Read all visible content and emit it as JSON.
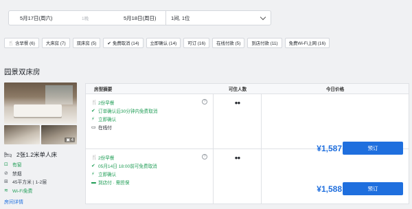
{
  "search": {
    "checkin": "5月17日(周六)",
    "nights": "1晚",
    "checkout": "5月18日(周日)",
    "guests": "1间, 1位"
  },
  "filters": [
    {
      "icon": "meal-icon",
      "glyph": "🍴",
      "label": "含早餐 (6)"
    },
    {
      "icon": "",
      "glyph": "",
      "label": "大床房 (7)"
    },
    {
      "icon": "",
      "glyph": "",
      "label": "双床房 (5)"
    },
    {
      "icon": "check-icon",
      "glyph": "✔",
      "label": "免费取消 (14)"
    },
    {
      "icon": "",
      "glyph": "",
      "label": "立即确认 (14)"
    },
    {
      "icon": "",
      "glyph": "",
      "label": "可订 (16)"
    },
    {
      "icon": "",
      "glyph": "",
      "label": "在线付款 (5)"
    },
    {
      "icon": "",
      "glyph": "",
      "label": "到店付款 (11)"
    },
    {
      "icon": "",
      "glyph": "",
      "label": "免费Wi-Fi上网 (16)"
    }
  ],
  "room": {
    "title": "园景双床房",
    "photo_count": "4",
    "bed": "2张1.2米单人床",
    "attributes": [
      {
        "icon": "window-icon",
        "glyph": "⊡",
        "text": "有窗",
        "green": true
      },
      {
        "icon": "no-smoking-icon",
        "glyph": "⊘",
        "text": "禁烟",
        "green": false
      },
      {
        "icon": "area-icon",
        "glyph": "⊞",
        "text": "45平方米 | 1-2层",
        "green": false
      },
      {
        "icon": "wifi-icon",
        "glyph": "≋",
        "text": "Wi-Fi免费",
        "green": true
      }
    ],
    "detail_link": "房间详情"
  },
  "table": {
    "headers": {
      "summary": "房型摘要",
      "guests": "可住人数",
      "price": "今日价格"
    },
    "rows": [
      {
        "lines": [
          {
            "glyph": "🍴",
            "text": "2份早餐",
            "green": true
          },
          {
            "glyph": "✔",
            "text": "订单确认后30分钟内免费取消",
            "green": true
          },
          {
            "glyph": "⚡",
            "text": "立即确认",
            "green": true
          },
          {
            "glyph": "▭",
            "text": "在线付",
            "green": false
          }
        ],
        "price": "¥1,587",
        "book_label": "预订"
      },
      {
        "lines": [
          {
            "glyph": "🍴",
            "text": "2份早餐",
            "green": true
          },
          {
            "glyph": "✔",
            "text": "05月14日 18:00前可免费取消",
            "green": true
          },
          {
            "glyph": "⚡",
            "text": "立即确认",
            "green": true
          },
          {
            "glyph": "▬",
            "text": "到店付 · 需担保",
            "green": true
          }
        ],
        "price": "¥1,588",
        "book_label": "预订"
      }
    ]
  },
  "colors": {
    "accent": "#1f6fde",
    "green": "#1f9d55"
  }
}
